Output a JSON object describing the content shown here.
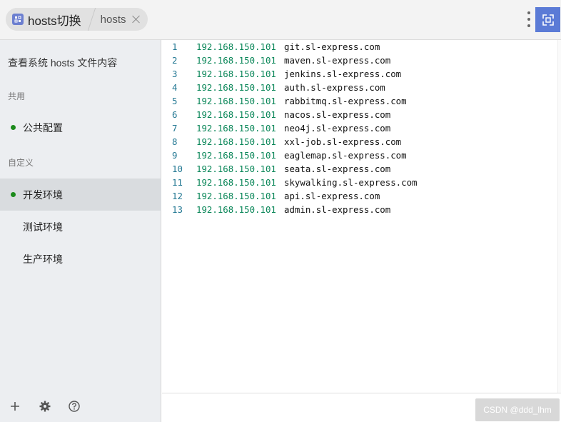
{
  "header": {
    "app_title": "hosts切换",
    "tab_label": "hosts",
    "icons": {
      "app": "app-logo-icon",
      "close": "close-icon",
      "more": "more-vertical-icon",
      "switch": "switch-view-icon"
    },
    "accent": "#5b7bd6"
  },
  "sidebar": {
    "view_system_label": "查看系统 hosts 文件内容",
    "groups": [
      {
        "label": "共用"
      },
      {
        "label": "自定义"
      }
    ],
    "items": [
      {
        "label": "公共配置",
        "enabled": true
      },
      {
        "label": "开发环境",
        "enabled": true,
        "active": true
      },
      {
        "label": "测试环境",
        "enabled": false
      },
      {
        "label": "生产环境",
        "enabled": false
      }
    ],
    "footer_icons": [
      "add-icon",
      "settings-icon",
      "help-icon"
    ]
  },
  "editor": {
    "lines": [
      {
        "n": "1",
        "ip": "192.168.150.101",
        "host": "git.sl-express.com"
      },
      {
        "n": "2",
        "ip": "192.168.150.101",
        "host": "maven.sl-express.com"
      },
      {
        "n": "3",
        "ip": "192.168.150.101",
        "host": "jenkins.sl-express.com"
      },
      {
        "n": "4",
        "ip": "192.168.150.101",
        "host": "auth.sl-express.com"
      },
      {
        "n": "5",
        "ip": "192.168.150.101",
        "host": "rabbitmq.sl-express.com"
      },
      {
        "n": "6",
        "ip": "192.168.150.101",
        "host": "nacos.sl-express.com"
      },
      {
        "n": "7",
        "ip": "192.168.150.101",
        "host": "neo4j.sl-express.com"
      },
      {
        "n": "8",
        "ip": "192.168.150.101",
        "host": "xxl-job.sl-express.com"
      },
      {
        "n": "9",
        "ip": "192.168.150.101",
        "host": "eaglemap.sl-express.com"
      },
      {
        "n": "10",
        "ip": "192.168.150.101",
        "host": "seata.sl-express.com"
      },
      {
        "n": "11",
        "ip": "192.168.150.101",
        "host": "skywalking.sl-express.com"
      },
      {
        "n": "12",
        "ip": "192.168.150.101",
        "host": "api.sl-express.com"
      },
      {
        "n": "13",
        "ip": "192.168.150.101",
        "host": "admin.sl-express.com"
      }
    ],
    "colors": {
      "line_number": "#237893",
      "ip": "#098658",
      "host": "#111111"
    }
  },
  "watermark": "CSDN @ddd_lhm"
}
